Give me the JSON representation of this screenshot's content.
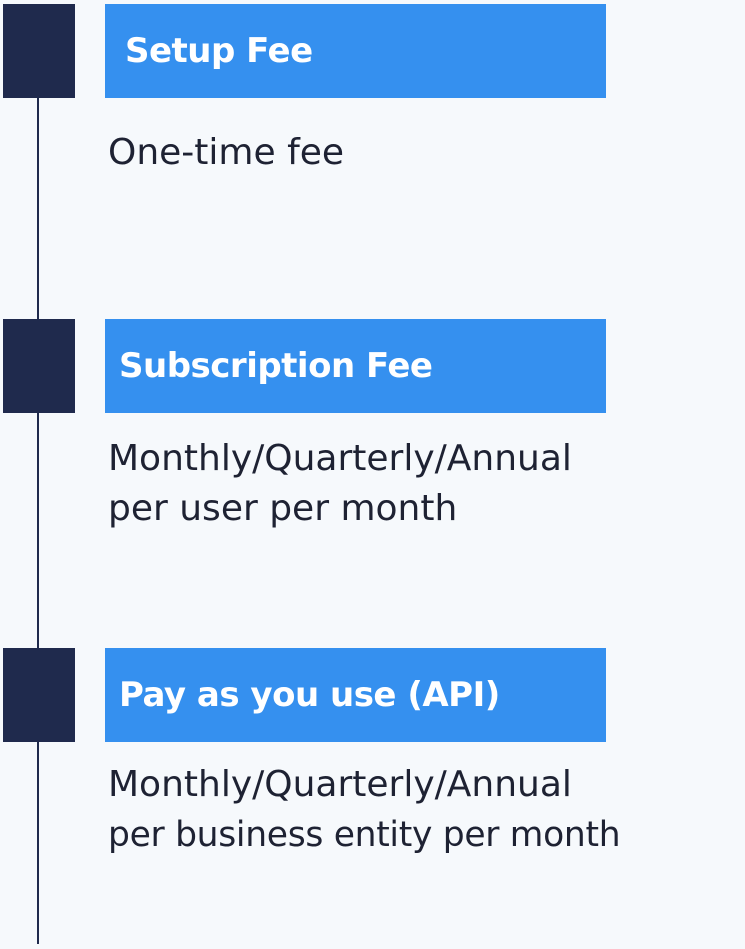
{
  "steps": [
    {
      "title": "Setup Fee",
      "lines": [
        "One-time fee"
      ]
    },
    {
      "title": "Subscription Fee",
      "lines": [
        "Monthly/Quarterly/Annual",
        "per user per month"
      ]
    },
    {
      "title": "Pay as you use (API)",
      "lines": [
        "Monthly/Quarterly/Annual",
        "per business entity per month"
      ]
    }
  ],
  "colors": {
    "background": "#f6f9fc",
    "marker": "#1f2a4d",
    "header": "#3590ef",
    "header_text": "#ffffff",
    "body_text": "#1e2233"
  }
}
